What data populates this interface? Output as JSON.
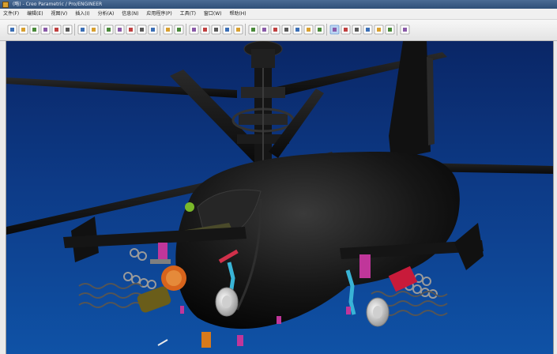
{
  "window": {
    "title": "(略) - Creo Parametric / Pro/ENGINEER"
  },
  "menu": {
    "items": [
      "文件(F)",
      "编辑(E)",
      "视图(V)",
      "插入(I)",
      "分析(A)",
      "信息(N)",
      "应用程序(P)",
      "工具(T)",
      "窗口(W)",
      "帮助(H)"
    ]
  },
  "toolbar": {
    "icons": [
      "new-icon",
      "open-icon",
      "save-icon",
      "print-icon",
      "mail-icon",
      "copy-icon",
      "window-icon",
      "undo-icon",
      "redo-icon",
      "cut-icon",
      "copy2-icon",
      "paste-icon",
      "paste-special-icon",
      "regenerate-icon",
      "find-icon",
      "select-icon",
      "refit-icon",
      "zoom-in-icon",
      "zoom-out-icon",
      "reorient-icon",
      "saved-views-icon",
      "layers-icon",
      "appearance-icon",
      "shading-icon",
      "hidden-line-icon",
      "no-hidden-icon",
      "wireframe-icon",
      "spin-center-icon",
      "datum-planes-icon",
      "datum-axes-icon",
      "datum-points-icon",
      "csys-icon",
      "annotation-icon",
      "help-icon"
    ]
  },
  "colors": {
    "viewport_top": "#0a2666",
    "viewport_bottom": "#0f52a6",
    "model_body": "#141414"
  }
}
